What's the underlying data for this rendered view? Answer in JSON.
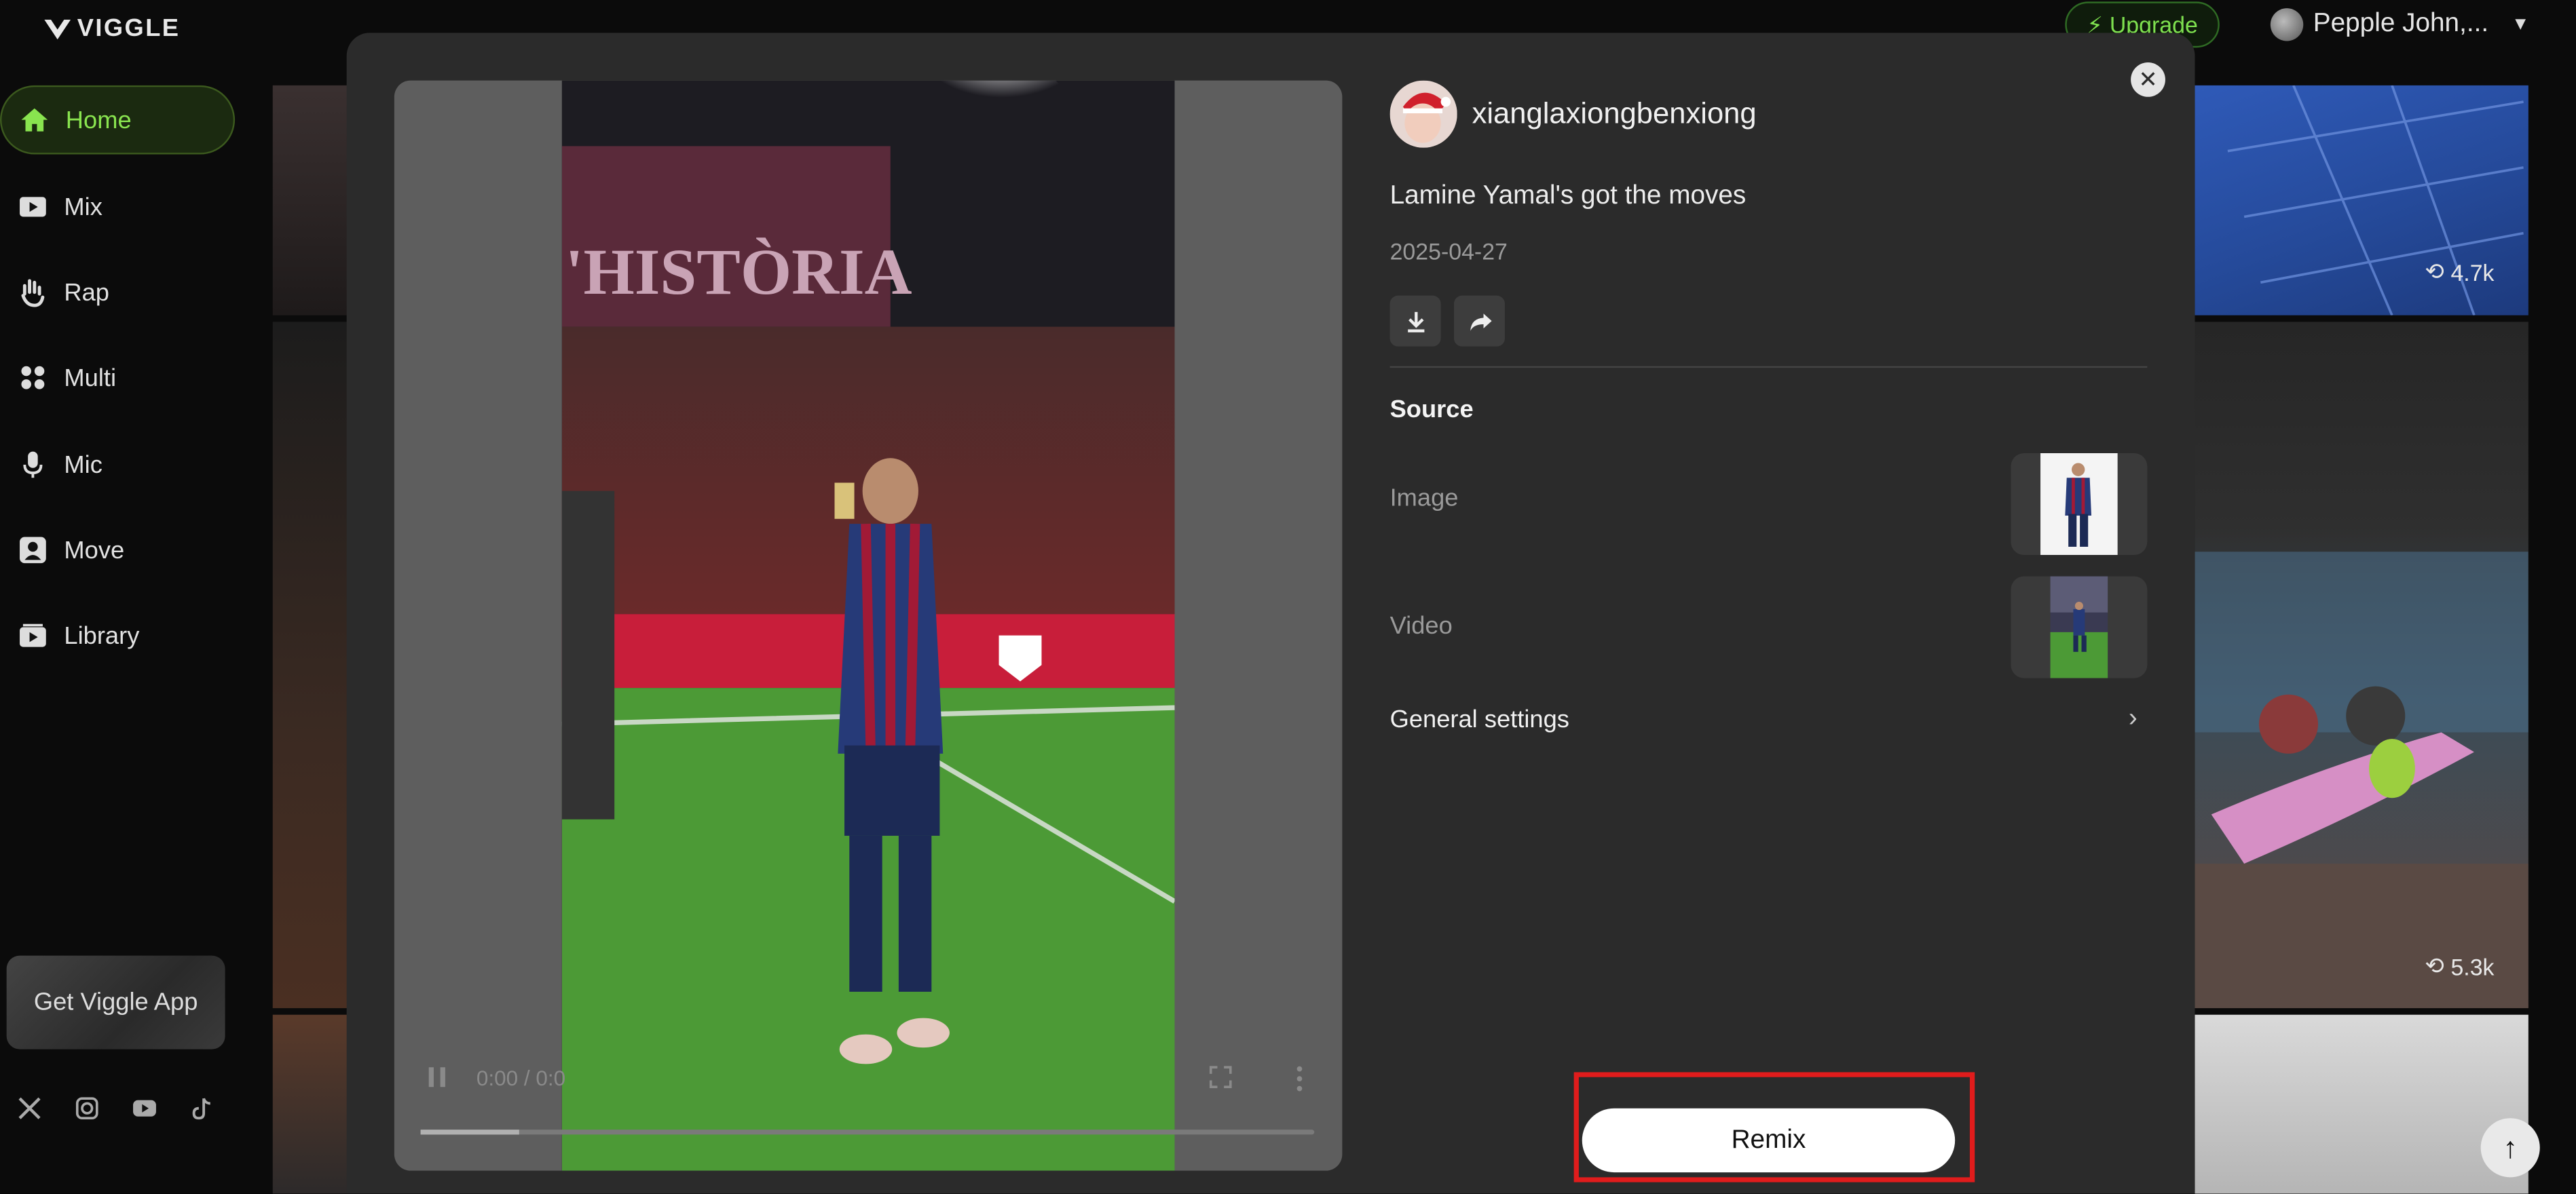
{
  "app": {
    "logo_text": "VIGGLE"
  },
  "header": {
    "upgrade_label": "Upgrade",
    "user_name": "Pepple John,..."
  },
  "sidebar": {
    "items": [
      {
        "label": "Home",
        "icon": "home-icon",
        "active": true
      },
      {
        "label": "Mix",
        "icon": "play-box-icon"
      },
      {
        "label": "Rap",
        "icon": "hand-icon"
      },
      {
        "label": "Multi",
        "icon": "multi-icon"
      },
      {
        "label": "Mic",
        "icon": "mic-icon"
      },
      {
        "label": "Move",
        "icon": "person-box-icon"
      },
      {
        "label": "Library",
        "icon": "library-icon"
      }
    ],
    "get_app_label": "Get Viggle App",
    "socials": [
      "x-icon",
      "instagram-icon",
      "youtube-icon",
      "tiktok-icon"
    ]
  },
  "background": {
    "counts": [
      "4.7k",
      "5.3k"
    ]
  },
  "modal": {
    "author": "xianglaxiongbenxiong",
    "title": "Lamine Yamal's got the moves",
    "date": "2025-04-27",
    "player": {
      "time": "0:00 / 0:0",
      "progress": 0.11
    },
    "source_heading": "Source",
    "image_label": "Image",
    "video_label": "Video",
    "general_settings_label": "General settings",
    "remix_label": "Remix"
  },
  "colors": {
    "accent": "#7ee04f",
    "highlight": "#e01c1c"
  }
}
